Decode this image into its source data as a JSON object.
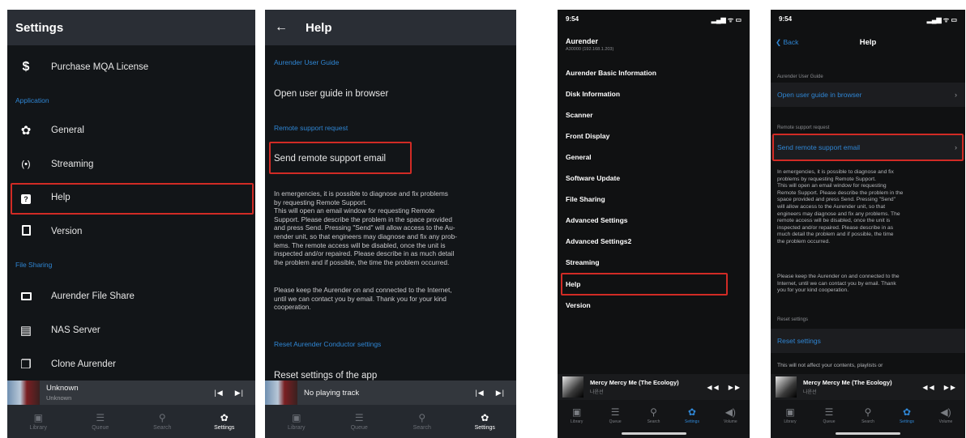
{
  "panel1": {
    "title": "Settings",
    "purchase": "Purchase MQA License",
    "section_application": "Application",
    "general": "General",
    "streaming": "Streaming",
    "help": "Help",
    "version": "Version",
    "section_file_sharing": "File Sharing",
    "file_share": "Aurender File Share",
    "nas": "NAS Server",
    "clone": "Clone Aurender",
    "mini_title": "Unknown",
    "mini_sub": "Unknown",
    "nav": [
      "Library",
      "Queue",
      "Search",
      "Settings"
    ],
    "highlight_color": "#d12b25"
  },
  "panel2": {
    "title": "Help",
    "section_guide": "Aurender User Guide",
    "open_guide": "Open user guide in browser",
    "section_remote": "Remote support request",
    "send_email": "Send remote support email",
    "desc1": "In emergencies, it is possible to diagnose and fix problems\nby requesting Remote Support.\nThis will open an email window for requesting Remote\nSupport. Please describe the problem in the space provided\nand press Send. Pressing \"Send\" will allow access to the Au-\nrender unit, so that engineers may diagnose and fix any prob-\nlems. The remote access will be disabled, once the unit is\ninspected and/or repaired. Please describe in as much detail\nthe problem and if possible, the time the problem occurred.",
    "desc2": "Please keep the Aurender on and connected to the Internet,\nuntil we can contact you by email. Thank you for your kind\ncooperation.",
    "section_reset": "Reset Aurender Conductor settings",
    "reset_app": "Reset settings of the app",
    "mini_title": "No playing track",
    "nav": [
      "Library",
      "Queue",
      "Search",
      "Settings"
    ]
  },
  "panel3": {
    "time": "9:54",
    "signal": "▂▄▆ ᯤ ▭",
    "device": "Aurender",
    "device_sub": "A30000 (192.168.1.203)",
    "items": [
      "Aurender Basic Information",
      "Disk Information",
      "Scanner",
      "Front Display",
      "General",
      "Software Update",
      "File Sharing",
      "Advanced Settings",
      "Advanced Settings2",
      "Streaming",
      "Help",
      "Version"
    ],
    "mini_title": "Mercy Mercy Me (The Ecology)",
    "mini_sub": "나윤선",
    "tabs": [
      "Library",
      "Queue",
      "Search",
      "Settings",
      "Volume"
    ]
  },
  "panel4": {
    "time": "9:54",
    "signal": "▂▄▆ ᯤ ▭",
    "back": "Back",
    "title": "Help",
    "section_guide": "Aurender User Guide",
    "open_guide": "Open user guide in browser",
    "section_remote": "Remote support request",
    "send_email": "Send remote support email",
    "desc1": "In emergencies, it is possible to diagnose and fix\nproblems by requesting Remote Support.\nThis will open an email window for requesting\nRemote Support. Please describe the problem in the\nspace provided and press Send. Pressing \"Send\"\nwill allow access to the Aurender unit, so that\nengineers may diagnose and fix any problems. The\nremote access will be disabled, once the unit is\ninspected and/or repaired. Please describe in as\nmuch detail the problem and if possible, the time\nthe problem occurred.",
    "desc2": "Please keep the Aurender on and connected to the\nInternet, until we can contact you by email. Thank\nyou for your kind cooperation.",
    "section_reset": "Reset settings",
    "reset": "Reset settings",
    "reset_desc": "This will not affect your contents, playlists or",
    "mini_title": "Mercy Mercy Me (The Ecology)",
    "mini_sub": "나윤선",
    "tabs": [
      "Library",
      "Queue",
      "Search",
      "Settings",
      "Volume"
    ]
  }
}
